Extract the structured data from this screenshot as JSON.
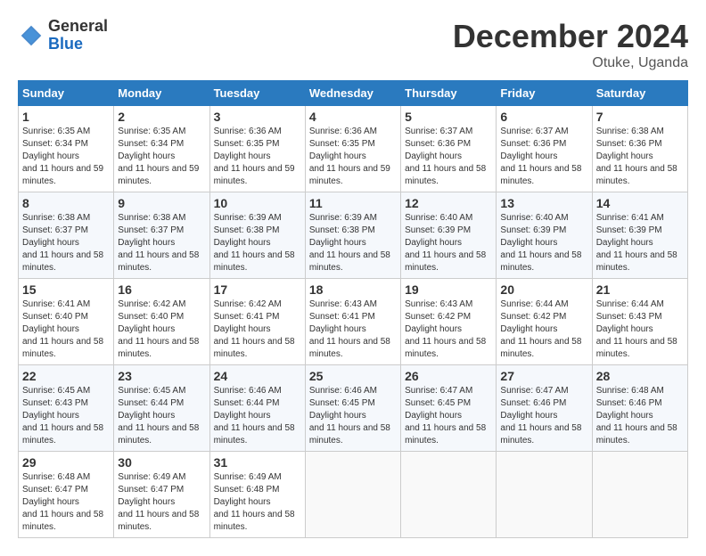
{
  "header": {
    "logo_general": "General",
    "logo_blue": "Blue",
    "month_title": "December 2024",
    "location": "Otuke, Uganda"
  },
  "days_of_week": [
    "Sunday",
    "Monday",
    "Tuesday",
    "Wednesday",
    "Thursday",
    "Friday",
    "Saturday"
  ],
  "weeks": [
    [
      {
        "day": "1",
        "sunrise": "6:35 AM",
        "sunset": "6:34 PM",
        "daylight": "11 hours and 59 minutes."
      },
      {
        "day": "2",
        "sunrise": "6:35 AM",
        "sunset": "6:34 PM",
        "daylight": "11 hours and 59 minutes."
      },
      {
        "day": "3",
        "sunrise": "6:36 AM",
        "sunset": "6:35 PM",
        "daylight": "11 hours and 59 minutes."
      },
      {
        "day": "4",
        "sunrise": "6:36 AM",
        "sunset": "6:35 PM",
        "daylight": "11 hours and 59 minutes."
      },
      {
        "day": "5",
        "sunrise": "6:37 AM",
        "sunset": "6:36 PM",
        "daylight": "11 hours and 58 minutes."
      },
      {
        "day": "6",
        "sunrise": "6:37 AM",
        "sunset": "6:36 PM",
        "daylight": "11 hours and 58 minutes."
      },
      {
        "day": "7",
        "sunrise": "6:38 AM",
        "sunset": "6:36 PM",
        "daylight": "11 hours and 58 minutes."
      }
    ],
    [
      {
        "day": "8",
        "sunrise": "6:38 AM",
        "sunset": "6:37 PM",
        "daylight": "11 hours and 58 minutes."
      },
      {
        "day": "9",
        "sunrise": "6:38 AM",
        "sunset": "6:37 PM",
        "daylight": "11 hours and 58 minutes."
      },
      {
        "day": "10",
        "sunrise": "6:39 AM",
        "sunset": "6:38 PM",
        "daylight": "11 hours and 58 minutes."
      },
      {
        "day": "11",
        "sunrise": "6:39 AM",
        "sunset": "6:38 PM",
        "daylight": "11 hours and 58 minutes."
      },
      {
        "day": "12",
        "sunrise": "6:40 AM",
        "sunset": "6:39 PM",
        "daylight": "11 hours and 58 minutes."
      },
      {
        "day": "13",
        "sunrise": "6:40 AM",
        "sunset": "6:39 PM",
        "daylight": "11 hours and 58 minutes."
      },
      {
        "day": "14",
        "sunrise": "6:41 AM",
        "sunset": "6:39 PM",
        "daylight": "11 hours and 58 minutes."
      }
    ],
    [
      {
        "day": "15",
        "sunrise": "6:41 AM",
        "sunset": "6:40 PM",
        "daylight": "11 hours and 58 minutes."
      },
      {
        "day": "16",
        "sunrise": "6:42 AM",
        "sunset": "6:40 PM",
        "daylight": "11 hours and 58 minutes."
      },
      {
        "day": "17",
        "sunrise": "6:42 AM",
        "sunset": "6:41 PM",
        "daylight": "11 hours and 58 minutes."
      },
      {
        "day": "18",
        "sunrise": "6:43 AM",
        "sunset": "6:41 PM",
        "daylight": "11 hours and 58 minutes."
      },
      {
        "day": "19",
        "sunrise": "6:43 AM",
        "sunset": "6:42 PM",
        "daylight": "11 hours and 58 minutes."
      },
      {
        "day": "20",
        "sunrise": "6:44 AM",
        "sunset": "6:42 PM",
        "daylight": "11 hours and 58 minutes."
      },
      {
        "day": "21",
        "sunrise": "6:44 AM",
        "sunset": "6:43 PM",
        "daylight": "11 hours and 58 minutes."
      }
    ],
    [
      {
        "day": "22",
        "sunrise": "6:45 AM",
        "sunset": "6:43 PM",
        "daylight": "11 hours and 58 minutes."
      },
      {
        "day": "23",
        "sunrise": "6:45 AM",
        "sunset": "6:44 PM",
        "daylight": "11 hours and 58 minutes."
      },
      {
        "day": "24",
        "sunrise": "6:46 AM",
        "sunset": "6:44 PM",
        "daylight": "11 hours and 58 minutes."
      },
      {
        "day": "25",
        "sunrise": "6:46 AM",
        "sunset": "6:45 PM",
        "daylight": "11 hours and 58 minutes."
      },
      {
        "day": "26",
        "sunrise": "6:47 AM",
        "sunset": "6:45 PM",
        "daylight": "11 hours and 58 minutes."
      },
      {
        "day": "27",
        "sunrise": "6:47 AM",
        "sunset": "6:46 PM",
        "daylight": "11 hours and 58 minutes."
      },
      {
        "day": "28",
        "sunrise": "6:48 AM",
        "sunset": "6:46 PM",
        "daylight": "11 hours and 58 minutes."
      }
    ],
    [
      {
        "day": "29",
        "sunrise": "6:48 AM",
        "sunset": "6:47 PM",
        "daylight": "11 hours and 58 minutes."
      },
      {
        "day": "30",
        "sunrise": "6:49 AM",
        "sunset": "6:47 PM",
        "daylight": "11 hours and 58 minutes."
      },
      {
        "day": "31",
        "sunrise": "6:49 AM",
        "sunset": "6:48 PM",
        "daylight": "11 hours and 58 minutes."
      },
      null,
      null,
      null,
      null
    ]
  ]
}
